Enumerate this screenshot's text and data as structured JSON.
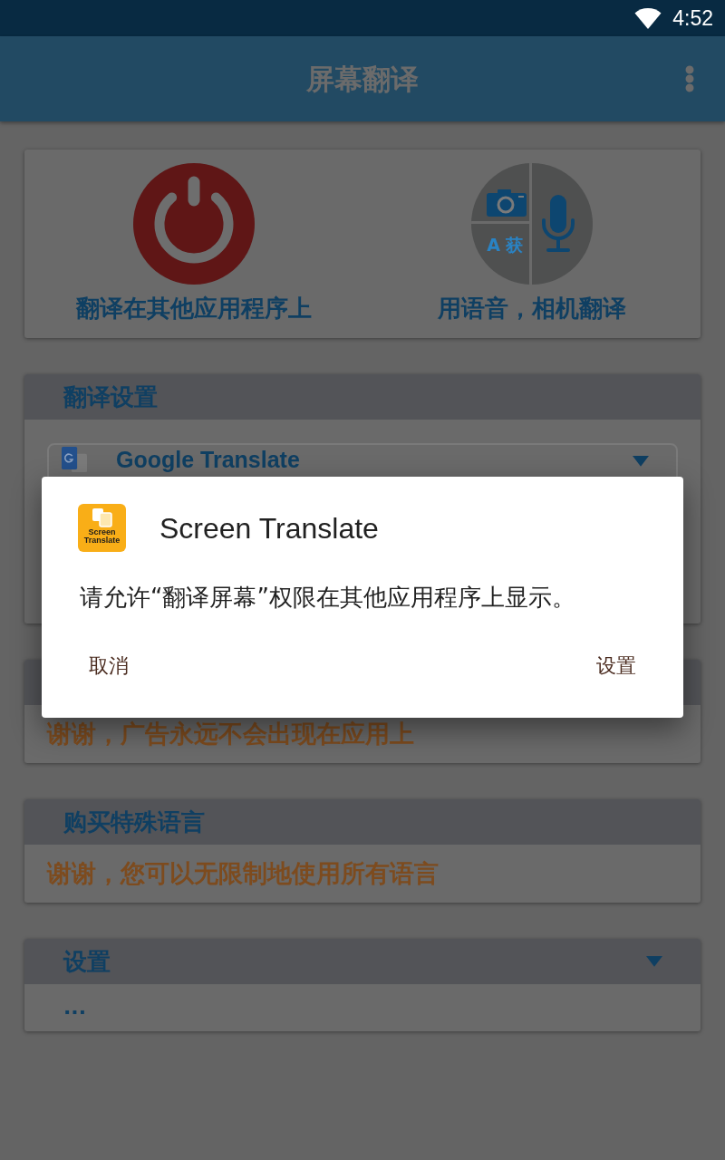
{
  "status_bar": {
    "time": "4:52"
  },
  "app_bar": {
    "title": "屏幕翻译"
  },
  "actions": [
    {
      "kind": "power",
      "label": "翻译在其他应用程序上"
    },
    {
      "kind": "voice_camera",
      "label": "用语音，相机翻译",
      "icon_text": "A 获"
    }
  ],
  "sections": [
    {
      "kind": "select",
      "title": "翻译设置",
      "value": "Google Translate"
    },
    {
      "kind": "note",
      "text": "谢谢，广告永远不会出现在应用上"
    },
    {
      "kind": "note",
      "title": "购买特殊语言",
      "text": "谢谢，您可以无限制地使用所有语言"
    },
    {
      "kind": "expandable",
      "title": "设置",
      "text": "..."
    }
  ],
  "dialog": {
    "title": "Screen Translate",
    "logo_text": "Screen Translate",
    "message": "请允许“翻译屏幕”权限在其他应用程序上显示。",
    "buttons": [
      "取消",
      "设置"
    ]
  }
}
